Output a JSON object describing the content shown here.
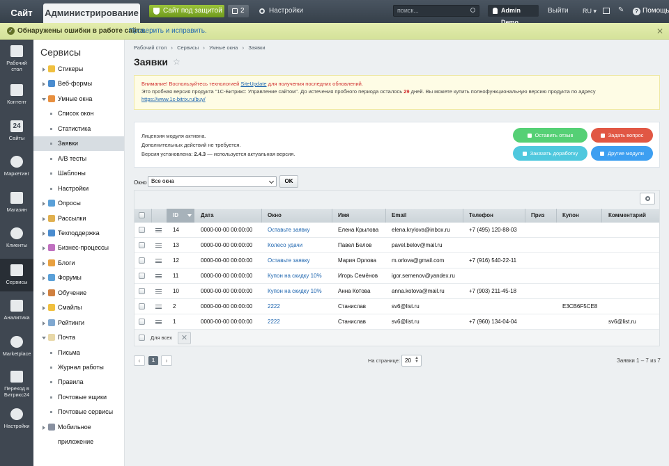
{
  "topbar": {
    "site_tab": "Сайт",
    "admin_tab": "Администрирование",
    "secure_button": "Сайт под защитой",
    "notifications_count": "2",
    "settings_label": "Настройки",
    "search_placeholder": "поиск...",
    "user_name": "Admin Demo",
    "logout_label": "Выйти",
    "lang": "RU",
    "help_label": "Помощь"
  },
  "errorbar": {
    "message": "Обнаружены ошибки в работе сайта.",
    "fix_link": "Проверить и исправить."
  },
  "iconbar": {
    "items": [
      {
        "label1": "Рабочий",
        "label2": "стол",
        "icon": "home-icon"
      },
      {
        "label1": "Контент",
        "label2": "",
        "icon": "content-icon"
      },
      {
        "label1": "Сайты",
        "label2": "",
        "icon": "calendar-icon",
        "badge": "24"
      },
      {
        "label1": "Маркетинг",
        "label2": "",
        "icon": "target-icon"
      },
      {
        "label1": "Магазин",
        "label2": "",
        "icon": "cart-icon"
      },
      {
        "label1": "Клиенты",
        "label2": "",
        "icon": "clients-icon"
      },
      {
        "label1": "Сервисы",
        "label2": "",
        "icon": "layers-icon"
      },
      {
        "label1": "Аналитика",
        "label2": "",
        "icon": "bars-icon"
      },
      {
        "label1": "Marketplace",
        "label2": "",
        "icon": "cloud-icon"
      },
      {
        "label1": "Переход в",
        "label2": "Битрикс24",
        "icon": "bitrix24-icon"
      },
      {
        "label1": "Настройки",
        "label2": "",
        "icon": "gear-icon"
      }
    ]
  },
  "services": {
    "title": "Сервисы",
    "items": [
      {
        "label": "Стикеры",
        "level": 0,
        "color": "#f0c040"
      },
      {
        "label": "Веб-формы",
        "level": 0,
        "color": "#4a8ccf"
      },
      {
        "label": "Умные окна",
        "level": 0,
        "color": "#e89040",
        "open": true
      },
      {
        "label": "Список окон",
        "level": 1
      },
      {
        "label": "Статистика",
        "level": 1
      },
      {
        "label": "Заявки",
        "level": 1,
        "selected": true
      },
      {
        "label": "A/B тесты",
        "level": 1
      },
      {
        "label": "Шаблоны",
        "level": 1
      },
      {
        "label": "Настройки",
        "level": 1
      },
      {
        "label": "Опросы",
        "level": 0,
        "color": "#5aa0d8"
      },
      {
        "label": "Рассылки",
        "level": 0,
        "color": "#e0b050"
      },
      {
        "label": "Техподдержка",
        "level": 0,
        "color": "#4a8ccf"
      },
      {
        "label": "Бизнес-процессы",
        "level": 0,
        "color": "#c070c0"
      },
      {
        "label": "Блоги",
        "level": 0,
        "color": "#e8a040"
      },
      {
        "label": "Форумы",
        "level": 0,
        "color": "#5aa0d8"
      },
      {
        "label": "Обучение",
        "level": 0,
        "color": "#d08040"
      },
      {
        "label": "Смайлы",
        "level": 0,
        "color": "#f0c040"
      },
      {
        "label": "Рейтинги",
        "level": 0,
        "color": "#80a8d0"
      },
      {
        "label": "Почта",
        "level": 0,
        "color": "#e8d8a8",
        "open": true
      },
      {
        "label": "Письма",
        "level": 1
      },
      {
        "label": "Журнал работы",
        "level": 1
      },
      {
        "label": "Правила",
        "level": 1
      },
      {
        "label": "Почтовые ящики",
        "level": 1
      },
      {
        "label": "Почтовые сервисы",
        "level": 1
      },
      {
        "label": "Мобильное приложение",
        "level": 0,
        "color": "#8890a0"
      }
    ]
  },
  "breadcrumb": {
    "items": [
      "Рабочий стол",
      "Сервисы",
      "Умные окна",
      "Заявки"
    ]
  },
  "page_title": "Заявки",
  "warning": {
    "line1_pre": "Внимание! Воспользуйтесь технологией ",
    "line1_link": "SiteUpdate",
    "line1_post": " для получения последних обновлений.",
    "line2_pre": "Это пробная версия продукта \"1С-Битрикс: Управление сайтом\". До истечения пробного периода осталось ",
    "days": "29",
    "line2_post": " дней. Вы можете купить полнофункциональную версию продукта по адресу",
    "line3_link": "https://www.1c-bitrix.ru/buy/"
  },
  "license": {
    "line1": "Лицензия модуля активна.",
    "line2": "Дополнительных действий не требуется.",
    "line3_pre": "Версия установлена: ",
    "version": "2.4.3",
    "line3_post": " — используется актуальная версия.",
    "btn_review": "Оставить отзыв",
    "btn_ask": "Задать вопрос",
    "btn_order": "Заказать доработку",
    "btn_modules": "Другие модули"
  },
  "filter": {
    "label": "Окно",
    "selected": "Все окна",
    "ok": "OK"
  },
  "grid": {
    "columns": [
      "ID",
      "Дата",
      "Окно",
      "Имя",
      "Email",
      "Телефон",
      "Приз",
      "Купон",
      "Комментарий"
    ],
    "rows": [
      {
        "id": "14",
        "date": "0000-00-00 00:00:00",
        "window": "Оставьте заявку",
        "name": "Елена Крылова",
        "email": "elena.krylova@inbox.ru",
        "phone": "+7 (495) 120-88-03",
        "prize": "",
        "coupon": "",
        "comment": ""
      },
      {
        "id": "13",
        "date": "0000-00-00 00:00:00",
        "window": "Колесо удачи",
        "name": "Павел Белов",
        "email": "pavel.belov@mail.ru",
        "phone": "",
        "prize": "",
        "coupon": "",
        "comment": ""
      },
      {
        "id": "12",
        "date": "0000-00-00 00:00:00",
        "window": "Оставьте заявку",
        "name": "Мария Орлова",
        "email": "m.orlova@gmail.com",
        "phone": "+7 (916) 540-22-11",
        "prize": "",
        "coupon": "",
        "comment": ""
      },
      {
        "id": "11",
        "date": "0000-00-00 00:00:00",
        "window": "Купон на скидку 10%",
        "name": "Игорь Семёнов",
        "email": "igor.semenov@yandex.ru",
        "phone": "",
        "prize": "",
        "coupon": "",
        "comment": ""
      },
      {
        "id": "10",
        "date": "0000-00-00 00:00:00",
        "window": "Купон на скидку 10%",
        "name": "Анна Котова",
        "email": "anna.kotova@mail.ru",
        "phone": "+7 (903) 211-45-18",
        "prize": "",
        "coupon": "",
        "comment": ""
      },
      {
        "id": "2",
        "date": "0000-00-00 00:00:00",
        "window": "2222",
        "name": "Станислав",
        "email": "sv6@list.ru",
        "phone": "",
        "prize": "",
        "coupon": "E3CB6F5CE8",
        "comment": ""
      },
      {
        "id": "1",
        "date": "0000-00-00 00:00:00",
        "window": "2222",
        "name": "Станислав",
        "email": "sv6@list.ru",
        "phone": "+7 (960) 134-04-04",
        "prize": "",
        "coupon": "",
        "comment": "sv6@list.ru"
      }
    ],
    "footer_label": "Для всех",
    "footer_x": "✕"
  },
  "pager": {
    "prev": "‹",
    "current": "1",
    "next": "›",
    "per_page_label": "На странице:",
    "per_page": "20",
    "total": "Заявки 1 – 7 из 7"
  }
}
